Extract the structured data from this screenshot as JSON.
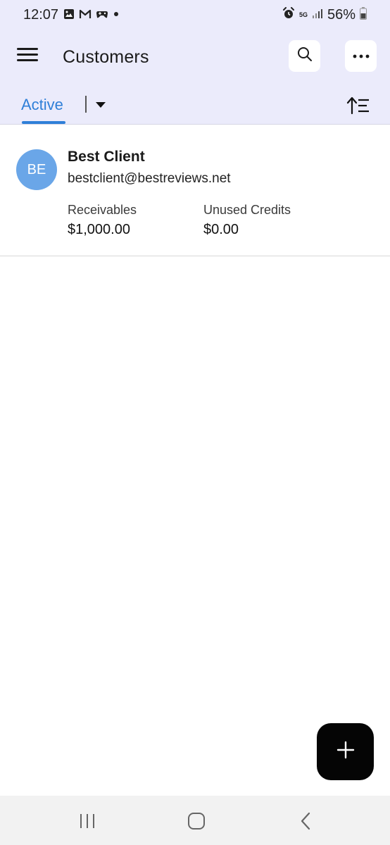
{
  "status_bar": {
    "time": "12:07",
    "network": "5G",
    "battery": "56%",
    "notification_icons": [
      "gallery-icon",
      "gmail-icon",
      "game-controller-icon",
      "dot-icon"
    ],
    "right_icons": [
      "alarm-icon",
      "signal-icon",
      "battery-icon"
    ]
  },
  "app_bar": {
    "title": "Customers",
    "menu_icon": "hamburger-menu-icon",
    "search_icon": "search-icon",
    "more_icon": "more-horizontal-icon"
  },
  "filter": {
    "active_tab": "Active",
    "dropdown_icon": "caret-down-icon",
    "sort_icon": "sort-icon"
  },
  "customers": [
    {
      "initials": "BE",
      "name": "Best Client",
      "email": "bestclient@bestreviews.net",
      "receivables_label": "Receivables",
      "receivables_value": "$1,000.00",
      "credits_label": "Unused Credits",
      "credits_value": "$0.00"
    }
  ],
  "fab": {
    "icon": "plus-icon"
  },
  "nav_bar": {
    "icons": [
      "recents-icon",
      "home-icon",
      "back-icon"
    ]
  },
  "colors": {
    "header_bg": "#ebebfb",
    "accent": "#2f7fd8",
    "avatar_bg": "#6aa6e8",
    "fab_bg": "#050505"
  }
}
